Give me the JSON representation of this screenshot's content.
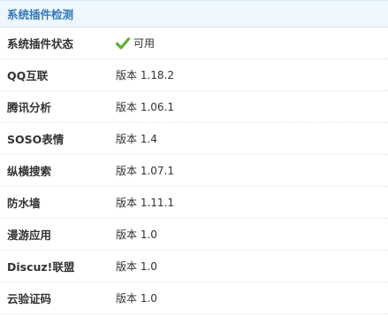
{
  "panel": {
    "title": "系统插件检测"
  },
  "rows": [
    {
      "label": "系统插件状态",
      "value": "可用",
      "icon": "check-icon",
      "icon_color": "#5bb02f"
    },
    {
      "label": "QQ互联",
      "value": "版本 1.18.2"
    },
    {
      "label": "腾讯分析",
      "value": "版本 1.06.1"
    },
    {
      "label": "SOSO表情",
      "value": "版本 1.4"
    },
    {
      "label": "纵横搜索",
      "value": "版本 1.07.1"
    },
    {
      "label": "防水墙",
      "value": "版本 1.11.1"
    },
    {
      "label": "漫游应用",
      "value": "版本 1.0"
    },
    {
      "label": "Discuz!联盟",
      "value": "版本 1.0"
    },
    {
      "label": "云验证码",
      "value": "版本 1.0"
    }
  ],
  "colors": {
    "title": "#2f79b8",
    "header_bg": "#eef7fd",
    "text": "#333333"
  }
}
